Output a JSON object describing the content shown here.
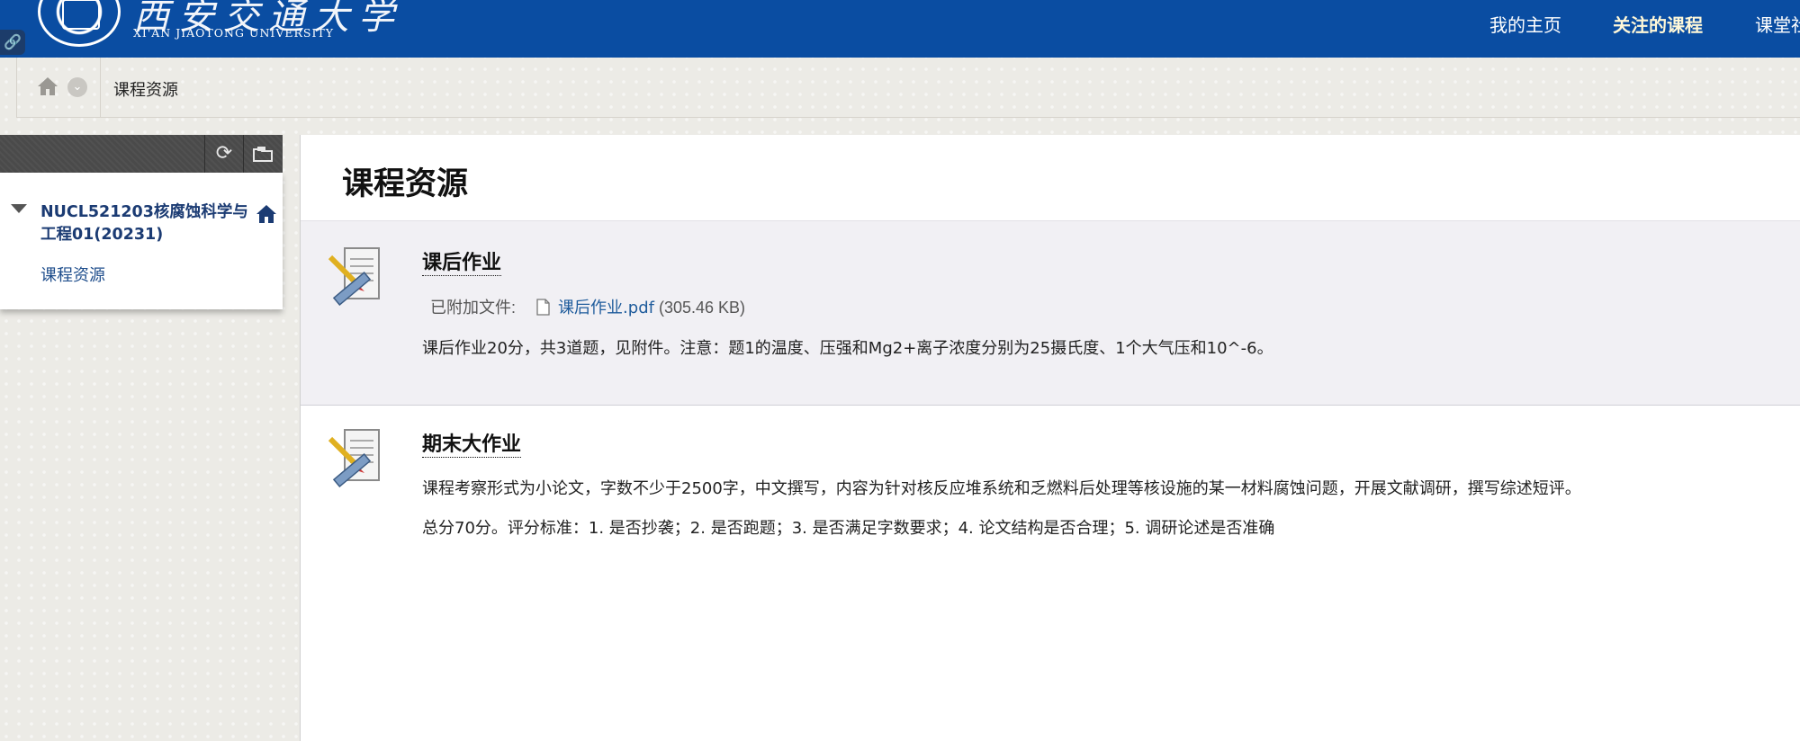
{
  "header": {
    "logo_script": "西安交通大学",
    "logo_en": "XI'AN JIAOTONG UNIVERSITY",
    "nav": [
      {
        "label": "我的主页",
        "active": false
      },
      {
        "label": "关注的课程",
        "active": true
      },
      {
        "label": "课堂社区",
        "active": false
      }
    ]
  },
  "breadcrumb": {
    "current": "课程资源"
  },
  "course_menu": {
    "course_title": "NUCL521203核腐蚀科学与工程01(20231)",
    "items": [
      {
        "label": "课程资源"
      }
    ]
  },
  "content": {
    "page_title": "课程资源",
    "items": [
      {
        "title": "课后作业",
        "attached_label": "已附加文件:",
        "file_name": "课后作业.pdf",
        "file_size": "(305.46 KB)",
        "paragraphs": [
          "课后作业20分，共3道题，见附件。注意：题1的温度、压强和Mg2+离子浓度分别为25摄氏度、1个大气压和10^-6。"
        ]
      },
      {
        "title": "期末大作业",
        "paragraphs": [
          "课程考察形式为小论文，字数不少于2500字，中文撰写，内容为针对核反应堆系统和乏燃料后处理等核设施的某一材料腐蚀问题，开展文献调研，撰写综述短评。",
          "总分70分。评分标准：1. 是否抄袭；2. 是否跑题；3. 是否满足字数要求；4. 论文结构是否合理；5. 调研论述是否准确"
        ]
      }
    ]
  },
  "colors": {
    "header_bg": "#0a4da2",
    "link": "#1f5c9c",
    "course_title": "#1b3b73",
    "highlight_row": "#f1f0f4"
  }
}
